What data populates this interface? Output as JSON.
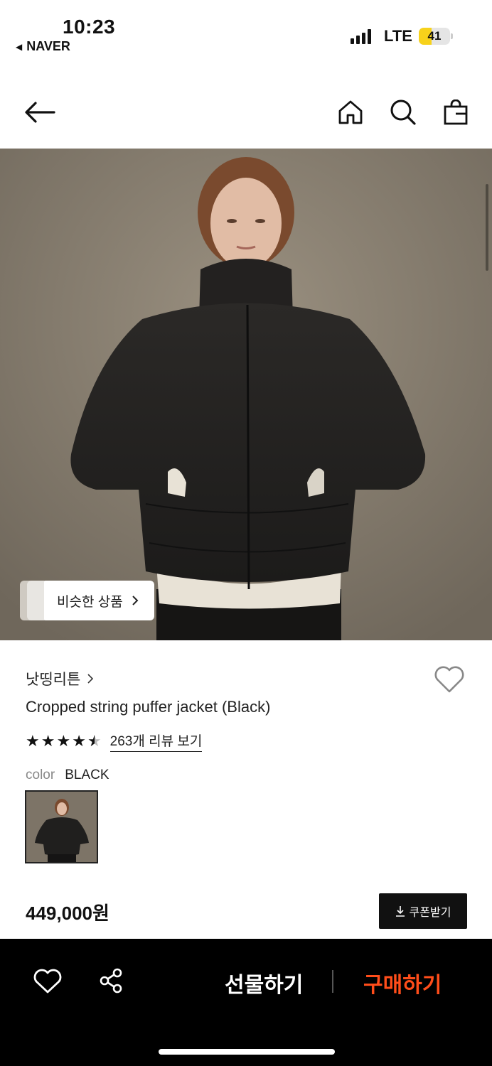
{
  "status_bar": {
    "time": "10:23",
    "back_app": "NAVER",
    "network": "LTE",
    "battery_level": 41,
    "battery_label": "41"
  },
  "nav": {
    "back_icon": "arrow-left-icon",
    "home_icon": "home-icon",
    "search_icon": "search-icon",
    "cart_icon": "shopping-bag-icon"
  },
  "hero": {
    "similar_label": "비슷한 상품"
  },
  "product": {
    "brand": "낫띵리튼",
    "name": "Cropped string puffer jacket (Black)",
    "rating": 4.5,
    "review_link": "263개 리뷰 보기",
    "color_key": "color",
    "color_value": "BLACK",
    "price": "449,000원",
    "coupon_label": "쿠폰받기"
  },
  "bottom_bar": {
    "gift_label": "선물하기",
    "buy_label": "구매하기"
  },
  "colors": {
    "accent": "#ff4d1a",
    "battery": "#f7d21b"
  }
}
